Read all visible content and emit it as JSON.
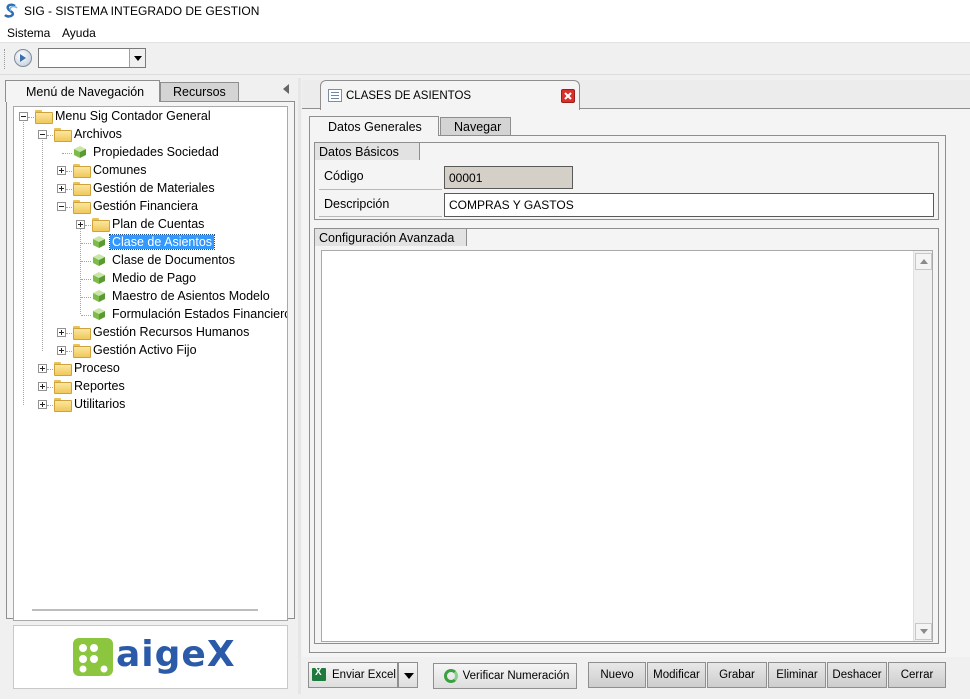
{
  "window": {
    "title": "SIG - SISTEMA INTEGRADO DE GESTION"
  },
  "menu": {
    "items": [
      "Sistema",
      "Ayuda"
    ]
  },
  "toolbar": {
    "combo_value": ""
  },
  "left_tabs": {
    "nav": "Menú de Navegación",
    "resources": "Recursos"
  },
  "tree": {
    "root": "Menu Sig  Contador General",
    "archivos": "Archivos",
    "propiedades": "Propiedades Sociedad",
    "comunes": "Comunes",
    "materiales": "Gestión de Materiales",
    "financiera": "Gestión Financiera",
    "plan": "Plan de Cuentas",
    "clase_asientos": "Clase de Asientos",
    "clase_documentos": "Clase de Documentos",
    "medio_pago": "Medio de Pago",
    "maestro": "Maestro de Asientos Modelo",
    "formulacion": "Formulación Estados Financieros",
    "rrhh": "Gestión Recursos Humanos",
    "activo": "Gestión Activo Fijo",
    "proceso": "Proceso",
    "reportes": "Reportes",
    "utilitarios": "Utilitarios"
  },
  "logo": {
    "text": "aigeX"
  },
  "document": {
    "tab_label": "CLASES DE ASIENTOS",
    "subtabs": {
      "general": "Datos Generales",
      "navigate": "Navegar"
    },
    "basic_group": "Datos Básicos",
    "codigo_label": "Código",
    "codigo_value": "00001",
    "descripcion_label": "Descripción",
    "descripcion_value": "COMPRAS Y GASTOS",
    "advanced_group": "Configuración Avanzada"
  },
  "buttons": {
    "excel": "Enviar Excel",
    "verificar": "Verificar Numeración",
    "nuevo": "Nuevo",
    "modificar": "Modificar",
    "grabar": "Grabar",
    "eliminar": "Eliminar",
    "deshacer": "Deshacer",
    "cerrar": "Cerrar"
  },
  "colors": {
    "selection": "#3399ff",
    "logo_green": "#8cc63f",
    "logo_blue": "#2a5aa8",
    "close_red": "#d9302c"
  }
}
